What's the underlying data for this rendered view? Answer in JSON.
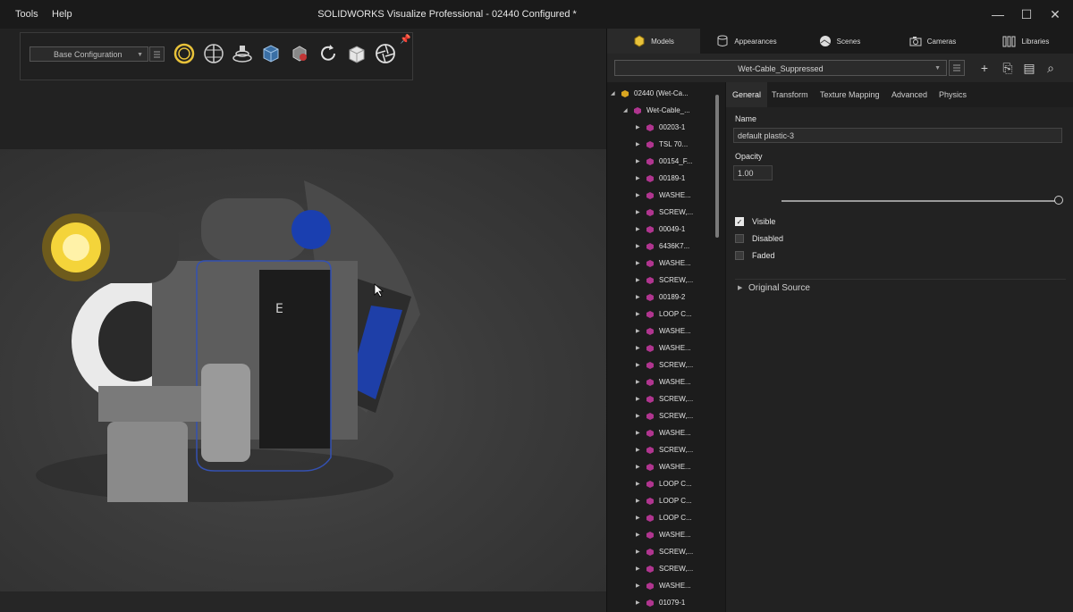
{
  "menu": {
    "tools": "Tools",
    "help": "Help"
  },
  "window": {
    "title": "SOLIDWORKS Visualize Professional - 02440 Configured *",
    "minimize": "—",
    "maximize": "☐",
    "close": "✕"
  },
  "toolbar": {
    "configuration": "Base Configuration",
    "pin": "📌",
    "icons": [
      "ring-icon",
      "explode-icon",
      "turntable-icon",
      "cube-wireframe-icon",
      "render-icon",
      "refresh-icon",
      "box-icon",
      "camera-aperture-icon"
    ]
  },
  "panel_tabs": [
    {
      "label": "Models",
      "icon": "cube-icon"
    },
    {
      "label": "Appearances",
      "icon": "cylinder-icon"
    },
    {
      "label": "Scenes",
      "icon": "scene-icon"
    },
    {
      "label": "Cameras",
      "icon": "camera-icon"
    },
    {
      "label": "Libraries",
      "icon": "library-icon"
    }
  ],
  "models_bar": {
    "selected_model": "Wet-Cable_Suppressed",
    "add": "+",
    "import": "⎘",
    "layout": "▤",
    "search": "⌕"
  },
  "tree": {
    "root": "02440 (Wet-Ca...",
    "group": "Wet-Cable_...",
    "items": [
      "00203-1",
      "TSL 70...",
      "00154_F...",
      "00189-1",
      "WASHE...",
      "SCREW,...",
      "00049-1",
      "6436K7...",
      "WASHE...",
      "SCREW,...",
      "00189-2",
      "LOOP C...",
      "WASHE...",
      "WASHE...",
      "SCREW,...",
      "WASHE...",
      "SCREW,...",
      "SCREW,...",
      "WASHE...",
      "SCREW,...",
      "WASHE...",
      "LOOP C...",
      "LOOP C...",
      "LOOP C...",
      "WASHE...",
      "SCREW,...",
      "SCREW,...",
      "WASHE...",
      "01079-1"
    ]
  },
  "properties": {
    "tabs": [
      "General",
      "Transform",
      "Texture Mapping",
      "Advanced",
      "Physics"
    ],
    "active_tab": "General",
    "name_label": "Name",
    "name_value": "default plastic-3",
    "opacity_label": "Opacity",
    "opacity_value": "1.00",
    "opacity_fraction": 1.0,
    "visible_label": "Visible",
    "visible_checked": true,
    "disabled_label": "Disabled",
    "disabled_checked": false,
    "faded_label": "Faded",
    "faded_checked": false,
    "original_source_label": "Original Source"
  },
  "colors": {
    "accent_gold": "#e8c23a",
    "part_magenta": "#b0358f",
    "root_gold": "#d9a520",
    "background": "#1b1b1b"
  }
}
